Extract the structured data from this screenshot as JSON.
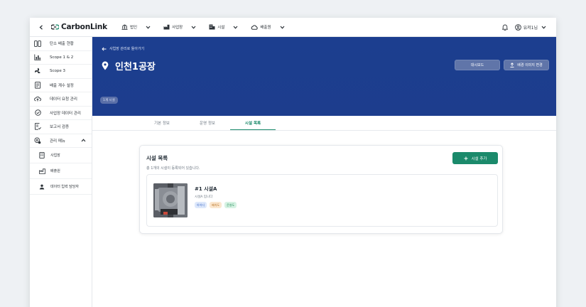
{
  "app": {
    "logo_text": "CarbonLink",
    "brand_color": "#1b8a6b",
    "banner_color": "#1c3e8f"
  },
  "topnav": {
    "items": [
      {
        "label": "법인",
        "icon": "bank-icon"
      },
      {
        "label": "사업장",
        "icon": "factory-icon"
      },
      {
        "label": "시설",
        "icon": "building-icon"
      },
      {
        "label": "배출원",
        "icon": "cloud-icon"
      }
    ],
    "user_label": "유저1님"
  },
  "sidebar": {
    "items": [
      {
        "label": "탄소 배출 현황",
        "icon": "columns-icon"
      },
      {
        "label": "Scope 1 & 2",
        "icon": "chart-icon"
      },
      {
        "label": "Scope 3",
        "icon": "fan-icon"
      },
      {
        "label": "배출 계수 설정",
        "icon": "document-grid-icon"
      },
      {
        "label": "데이터 요청 관리",
        "icon": "cloud-upload-icon"
      },
      {
        "label": "사업장 데이터 관리",
        "icon": "check-circle-icon"
      },
      {
        "label": "보고서 검증",
        "icon": "report-check-icon"
      },
      {
        "label": "관리 메뉴",
        "icon": "settings-gear-icon"
      }
    ],
    "sub_items": [
      {
        "label": "사업장",
        "icon": "building-icon"
      },
      {
        "label": "배출원",
        "icon": "factory-icon"
      },
      {
        "label": "데이터 입력 담당자",
        "icon": "person-icon"
      }
    ]
  },
  "banner": {
    "back_label": "사업장 관리로 돌아가기",
    "site_title": "인천1공장",
    "badge": "1개 시설",
    "dashboard_button": "대시보드",
    "bg_button": "배경 이미지 변경"
  },
  "tabs": [
    {
      "label": "기본 정보"
    },
    {
      "label": "운영 정보"
    },
    {
      "label": "시설 목록",
      "active": true
    }
  ],
  "facility_list": {
    "title": "시설 목록",
    "subtitle": "총 1개의 시설이 등록되어 있습니다.",
    "add_button": "시설 추가",
    "facilities": [
      {
        "name": "#1 시설A",
        "description": "시설A 입니다",
        "tags": [
          "아이디",
          "배치도",
          "운영도"
        ]
      }
    ]
  }
}
